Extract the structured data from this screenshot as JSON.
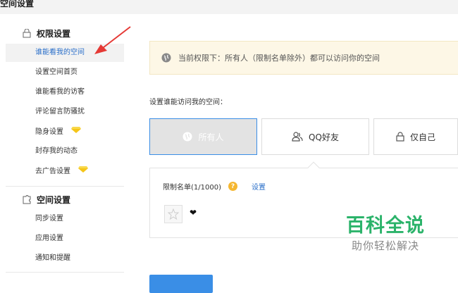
{
  "window": {
    "title": "空间设置"
  },
  "sidebar": {
    "sections": [
      {
        "heading": "权限设置",
        "icon": "lock-icon",
        "items": [
          {
            "label": "谁能看我的空间",
            "active": true
          },
          {
            "label": "设置空间首页"
          },
          {
            "label": "谁能看我的访客"
          },
          {
            "label": "评论留言防骚扰"
          },
          {
            "label": "隐身设置",
            "badge": "diamond-icon"
          },
          {
            "label": "封存我的动态"
          },
          {
            "label": "去广告设置",
            "badge": "diamond-icon"
          }
        ]
      },
      {
        "heading": "空间设置",
        "icon": "puzzle-icon",
        "items": [
          {
            "label": "同步设置"
          },
          {
            "label": "应用设置"
          },
          {
            "label": "通知和提醒"
          }
        ]
      }
    ]
  },
  "main": {
    "notice": "当前权限下：所有人（限制名单除外）都可以访问你的空间",
    "question": "设置谁能访问我的空间：",
    "options": [
      {
        "label": "所有人",
        "icon": "globe-icon",
        "selected": true
      },
      {
        "label": "QQ好友",
        "icon": "friends-icon"
      },
      {
        "label": "仅自己",
        "icon": "lock-icon"
      }
    ],
    "limit": {
      "label": "限制名单(1/1000)",
      "help": "?",
      "set_link": "设置",
      "heart": "❤"
    }
  },
  "watermark": {
    "title": "百科全说",
    "subtitle": "助你轻松解决"
  },
  "colors": {
    "accent": "#3a8ee6",
    "link": "#2a6fc9",
    "notice_bg": "#fdf7e6",
    "gem": "#f5c518",
    "annotation_arrow": "#e53935",
    "watermark": "#2bb36a"
  }
}
